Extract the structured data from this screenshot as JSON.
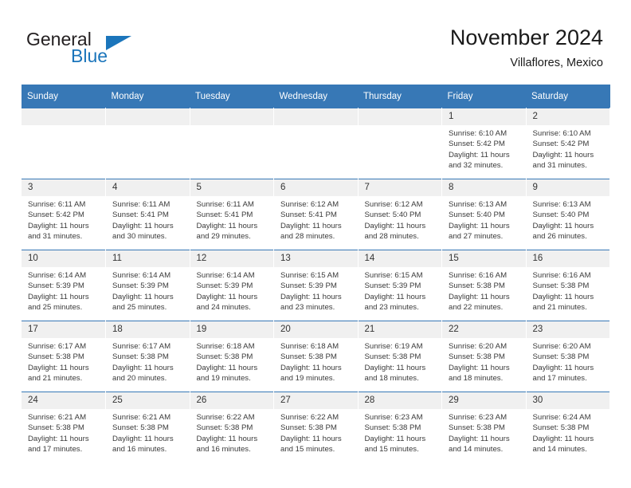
{
  "brand": {
    "name_part1": "General",
    "name_part2": "Blue",
    "accent_color": "#1b75bb"
  },
  "header": {
    "title": "November 2024",
    "subtitle": "Villaflores, Mexico"
  },
  "calendar": {
    "header_color": "#3778b6",
    "weekday_headers": [
      "Sunday",
      "Monday",
      "Tuesday",
      "Wednesday",
      "Thursday",
      "Friday",
      "Saturday"
    ],
    "weeks": [
      [
        {
          "day": "",
          "empty": true
        },
        {
          "day": "",
          "empty": true
        },
        {
          "day": "",
          "empty": true
        },
        {
          "day": "",
          "empty": true
        },
        {
          "day": "",
          "empty": true
        },
        {
          "day": "1",
          "sunrise": "Sunrise: 6:10 AM",
          "sunset": "Sunset: 5:42 PM",
          "daylight": "Daylight: 11 hours and 32 minutes."
        },
        {
          "day": "2",
          "sunrise": "Sunrise: 6:10 AM",
          "sunset": "Sunset: 5:42 PM",
          "daylight": "Daylight: 11 hours and 31 minutes."
        }
      ],
      [
        {
          "day": "3",
          "sunrise": "Sunrise: 6:11 AM",
          "sunset": "Sunset: 5:42 PM",
          "daylight": "Daylight: 11 hours and 31 minutes."
        },
        {
          "day": "4",
          "sunrise": "Sunrise: 6:11 AM",
          "sunset": "Sunset: 5:41 PM",
          "daylight": "Daylight: 11 hours and 30 minutes."
        },
        {
          "day": "5",
          "sunrise": "Sunrise: 6:11 AM",
          "sunset": "Sunset: 5:41 PM",
          "daylight": "Daylight: 11 hours and 29 minutes."
        },
        {
          "day": "6",
          "sunrise": "Sunrise: 6:12 AM",
          "sunset": "Sunset: 5:41 PM",
          "daylight": "Daylight: 11 hours and 28 minutes."
        },
        {
          "day": "7",
          "sunrise": "Sunrise: 6:12 AM",
          "sunset": "Sunset: 5:40 PM",
          "daylight": "Daylight: 11 hours and 28 minutes."
        },
        {
          "day": "8",
          "sunrise": "Sunrise: 6:13 AM",
          "sunset": "Sunset: 5:40 PM",
          "daylight": "Daylight: 11 hours and 27 minutes."
        },
        {
          "day": "9",
          "sunrise": "Sunrise: 6:13 AM",
          "sunset": "Sunset: 5:40 PM",
          "daylight": "Daylight: 11 hours and 26 minutes."
        }
      ],
      [
        {
          "day": "10",
          "sunrise": "Sunrise: 6:14 AM",
          "sunset": "Sunset: 5:39 PM",
          "daylight": "Daylight: 11 hours and 25 minutes."
        },
        {
          "day": "11",
          "sunrise": "Sunrise: 6:14 AM",
          "sunset": "Sunset: 5:39 PM",
          "daylight": "Daylight: 11 hours and 25 minutes."
        },
        {
          "day": "12",
          "sunrise": "Sunrise: 6:14 AM",
          "sunset": "Sunset: 5:39 PM",
          "daylight": "Daylight: 11 hours and 24 minutes."
        },
        {
          "day": "13",
          "sunrise": "Sunrise: 6:15 AM",
          "sunset": "Sunset: 5:39 PM",
          "daylight": "Daylight: 11 hours and 23 minutes."
        },
        {
          "day": "14",
          "sunrise": "Sunrise: 6:15 AM",
          "sunset": "Sunset: 5:39 PM",
          "daylight": "Daylight: 11 hours and 23 minutes."
        },
        {
          "day": "15",
          "sunrise": "Sunrise: 6:16 AM",
          "sunset": "Sunset: 5:38 PM",
          "daylight": "Daylight: 11 hours and 22 minutes."
        },
        {
          "day": "16",
          "sunrise": "Sunrise: 6:16 AM",
          "sunset": "Sunset: 5:38 PM",
          "daylight": "Daylight: 11 hours and 21 minutes."
        }
      ],
      [
        {
          "day": "17",
          "sunrise": "Sunrise: 6:17 AM",
          "sunset": "Sunset: 5:38 PM",
          "daylight": "Daylight: 11 hours and 21 minutes."
        },
        {
          "day": "18",
          "sunrise": "Sunrise: 6:17 AM",
          "sunset": "Sunset: 5:38 PM",
          "daylight": "Daylight: 11 hours and 20 minutes."
        },
        {
          "day": "19",
          "sunrise": "Sunrise: 6:18 AM",
          "sunset": "Sunset: 5:38 PM",
          "daylight": "Daylight: 11 hours and 19 minutes."
        },
        {
          "day": "20",
          "sunrise": "Sunrise: 6:18 AM",
          "sunset": "Sunset: 5:38 PM",
          "daylight": "Daylight: 11 hours and 19 minutes."
        },
        {
          "day": "21",
          "sunrise": "Sunrise: 6:19 AM",
          "sunset": "Sunset: 5:38 PM",
          "daylight": "Daylight: 11 hours and 18 minutes."
        },
        {
          "day": "22",
          "sunrise": "Sunrise: 6:20 AM",
          "sunset": "Sunset: 5:38 PM",
          "daylight": "Daylight: 11 hours and 18 minutes."
        },
        {
          "day": "23",
          "sunrise": "Sunrise: 6:20 AM",
          "sunset": "Sunset: 5:38 PM",
          "daylight": "Daylight: 11 hours and 17 minutes."
        }
      ],
      [
        {
          "day": "24",
          "sunrise": "Sunrise: 6:21 AM",
          "sunset": "Sunset: 5:38 PM",
          "daylight": "Daylight: 11 hours and 17 minutes."
        },
        {
          "day": "25",
          "sunrise": "Sunrise: 6:21 AM",
          "sunset": "Sunset: 5:38 PM",
          "daylight": "Daylight: 11 hours and 16 minutes."
        },
        {
          "day": "26",
          "sunrise": "Sunrise: 6:22 AM",
          "sunset": "Sunset: 5:38 PM",
          "daylight": "Daylight: 11 hours and 16 minutes."
        },
        {
          "day": "27",
          "sunrise": "Sunrise: 6:22 AM",
          "sunset": "Sunset: 5:38 PM",
          "daylight": "Daylight: 11 hours and 15 minutes."
        },
        {
          "day": "28",
          "sunrise": "Sunrise: 6:23 AM",
          "sunset": "Sunset: 5:38 PM",
          "daylight": "Daylight: 11 hours and 15 minutes."
        },
        {
          "day": "29",
          "sunrise": "Sunrise: 6:23 AM",
          "sunset": "Sunset: 5:38 PM",
          "daylight": "Daylight: 11 hours and 14 minutes."
        },
        {
          "day": "30",
          "sunrise": "Sunrise: 6:24 AM",
          "sunset": "Sunset: 5:38 PM",
          "daylight": "Daylight: 11 hours and 14 minutes."
        }
      ]
    ]
  }
}
